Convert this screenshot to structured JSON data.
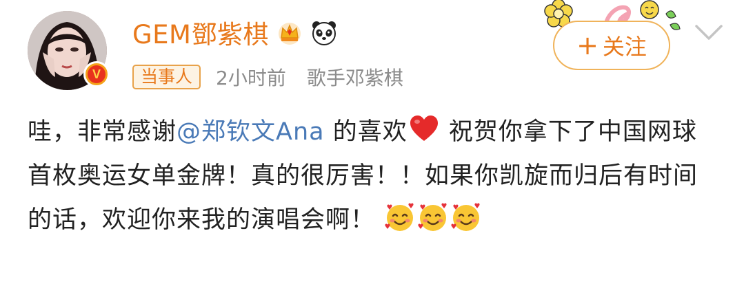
{
  "header": {
    "username": "GEM鄧紫棋",
    "party_tag": "当事人",
    "time": "2小时前",
    "source": "歌手邓紫棋",
    "follow_label": "关注",
    "follow_plus": "+"
  },
  "post": {
    "text_before_mention": "哇，非常感谢",
    "mention": "@郑钦文Ana",
    "text_after_mention": " 的喜欢",
    "heart_emoji": "❤️",
    "text_after_heart": " 祝贺你拿下了中国网球首枚奥运女单金牌！真的很厉害！！如果你凯旋而归后有时间的话，欢迎你来我的演唱会啊！",
    "trailing_emojis": [
      "🥰",
      "🥰",
      "🥰"
    ]
  },
  "icons": {
    "verified": "verified-v-badge-icon",
    "crown": "crown-icon",
    "panda": "panda-icon",
    "more": "chevron-down-icon",
    "sticker": "flower-sticker-icon"
  },
  "colors": {
    "accent": "#e8791c",
    "mention": "#4a7ab7",
    "meta": "#8c8c8c",
    "text": "#222222"
  }
}
